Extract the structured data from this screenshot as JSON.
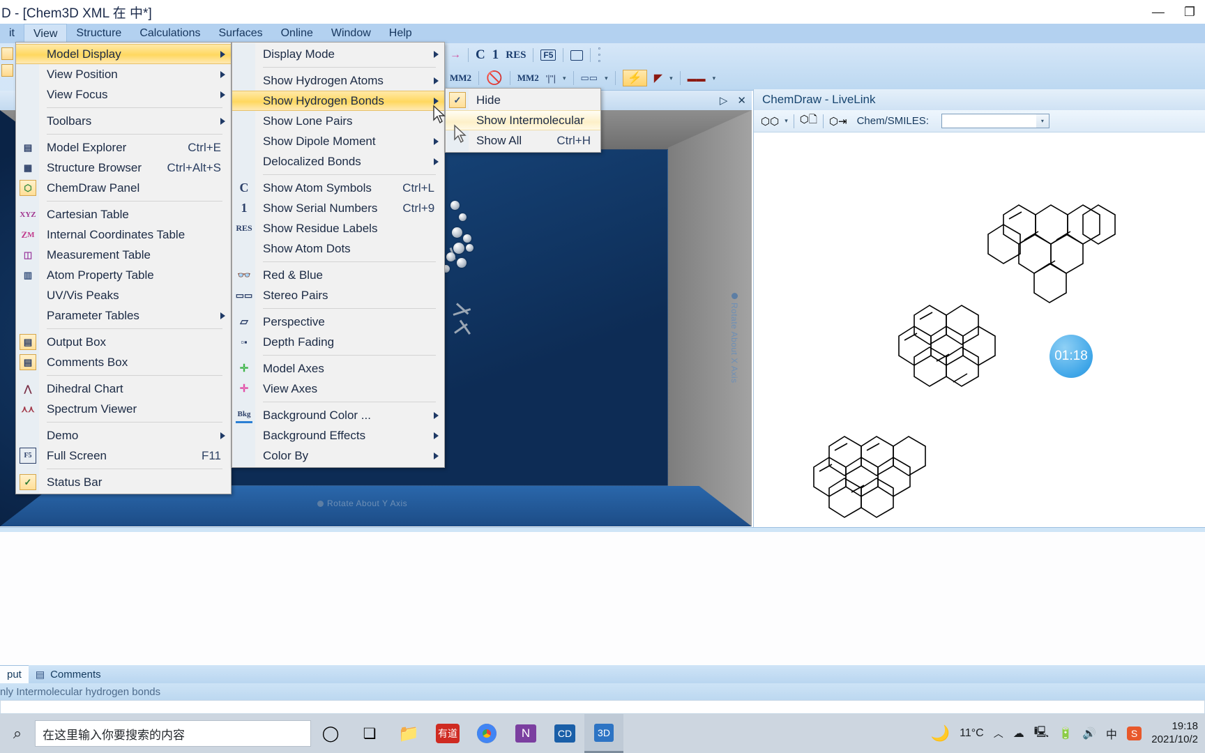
{
  "window": {
    "title": "D - [Chem3D XML 在 中*]",
    "controls": {
      "minimize": "—",
      "maximize": "❐"
    }
  },
  "menubar": {
    "items": [
      {
        "label": "it",
        "active": false
      },
      {
        "label": "View",
        "active": true
      },
      {
        "label": "Structure",
        "active": false
      },
      {
        "label": "Calculations",
        "active": false
      },
      {
        "label": "Surfaces",
        "active": false
      },
      {
        "label": "Online",
        "active": false
      },
      {
        "label": "Window",
        "active": false
      },
      {
        "label": "Help",
        "active": false
      }
    ]
  },
  "toolbar": {
    "row1": [
      "C",
      "1",
      "RES",
      "F5",
      "screen-icon",
      "dots-icon"
    ],
    "row2": [
      "MM2",
      "no-icon",
      "MM2",
      "bond-icon",
      "box-icon",
      "lightning-icon",
      "ramp-icon",
      "line-icon"
    ]
  },
  "view_menu": {
    "name": "View",
    "items": [
      {
        "icon": "",
        "label": "Model Display",
        "shortcut": "",
        "arrow": true,
        "highlight": "strong"
      },
      {
        "icon": "",
        "label": "View Position",
        "shortcut": "",
        "arrow": true
      },
      {
        "icon": "",
        "label": "View Focus",
        "shortcut": "",
        "arrow": true
      },
      {
        "separator": true
      },
      {
        "icon": "",
        "label": "Toolbars",
        "shortcut": "",
        "arrow": true
      },
      {
        "separator": true
      },
      {
        "icon": "model-explorer-icon",
        "label": "Model Explorer",
        "shortcut": "Ctrl+E"
      },
      {
        "icon": "structure-browser-icon",
        "label": "Structure Browser",
        "shortcut": "Ctrl+Alt+S"
      },
      {
        "icon": "chemdraw-panel-icon",
        "label": "ChemDraw Panel",
        "shortcut": "",
        "framed": true
      },
      {
        "separator": true
      },
      {
        "icon": "xyz-icon",
        "label": "Cartesian Table",
        "shortcut": ""
      },
      {
        "icon": "zm-icon",
        "label": "Internal Coordinates Table",
        "shortcut": ""
      },
      {
        "icon": "measurement-icon",
        "label": "Measurement Table",
        "shortcut": ""
      },
      {
        "icon": "atom-property-icon",
        "label": "Atom Property Table",
        "shortcut": ""
      },
      {
        "icon": "",
        "label": "UV/Vis Peaks",
        "shortcut": ""
      },
      {
        "icon": "",
        "label": "Parameter Tables",
        "shortcut": "",
        "arrow": true
      },
      {
        "separator": true
      },
      {
        "icon": "output-box-icon",
        "label": "Output Box",
        "shortcut": "",
        "framed": true
      },
      {
        "icon": "comments-box-icon",
        "label": "Comments Box",
        "shortcut": "",
        "framed": true
      },
      {
        "separator": true
      },
      {
        "icon": "dihedral-chart-icon",
        "label": "Dihedral Chart",
        "shortcut": ""
      },
      {
        "icon": "spectrum-viewer-icon",
        "label": "Spectrum Viewer",
        "shortcut": ""
      },
      {
        "separator": true
      },
      {
        "icon": "",
        "label": "Demo",
        "shortcut": "",
        "arrow": true
      },
      {
        "icon": "fullscreen-icon",
        "label": "Full Screen",
        "shortcut": "F11"
      },
      {
        "separator": true
      },
      {
        "icon": "check-icon",
        "label": "Status Bar",
        "shortcut": "",
        "framed": true
      }
    ]
  },
  "model_display_menu": {
    "name": "Model Display",
    "items": [
      {
        "icon": "",
        "label": "Display Mode",
        "shortcut": "",
        "arrow": true
      },
      {
        "separator": true
      },
      {
        "icon": "",
        "label": "Show Hydrogen Atoms",
        "shortcut": "",
        "arrow": true
      },
      {
        "icon": "",
        "label": "Show Hydrogen Bonds",
        "shortcut": "",
        "arrow": true,
        "highlight": "strong"
      },
      {
        "icon": "",
        "label": "Show Lone Pairs",
        "shortcut": ""
      },
      {
        "icon": "",
        "label": "Show Dipole Moment",
        "shortcut": "",
        "arrow": true
      },
      {
        "icon": "",
        "label": "Delocalized Bonds",
        "shortcut": "",
        "arrow": true
      },
      {
        "separator": true
      },
      {
        "icon": "C",
        "label": "Show Atom Symbols",
        "shortcut": "Ctrl+L"
      },
      {
        "icon": "1",
        "label": "Show Serial Numbers",
        "shortcut": "Ctrl+9"
      },
      {
        "icon": "RES",
        "label": "Show Residue Labels",
        "shortcut": ""
      },
      {
        "icon": "",
        "label": "Show Atom Dots",
        "shortcut": ""
      },
      {
        "separator": true
      },
      {
        "icon": "red-blue-glasses-icon",
        "label": "Red & Blue",
        "shortcut": ""
      },
      {
        "icon": "stereo-pairs-icon",
        "label": "Stereo Pairs",
        "shortcut": ""
      },
      {
        "separator": true
      },
      {
        "icon": "perspective-icon",
        "label": "Perspective",
        "shortcut": ""
      },
      {
        "icon": "depth-fading-icon",
        "label": "Depth Fading",
        "shortcut": ""
      },
      {
        "separator": true
      },
      {
        "icon": "model-axes-icon",
        "label": "Model Axes",
        "shortcut": ""
      },
      {
        "icon": "view-axes-icon",
        "label": "View Axes",
        "shortcut": ""
      },
      {
        "separator": true
      },
      {
        "icon": "bkg-icon",
        "label": "Background Color ...",
        "shortcut": "",
        "arrow": true
      },
      {
        "icon": "",
        "label": "Background Effects",
        "shortcut": "",
        "arrow": true
      },
      {
        "icon": "",
        "label": "Color By",
        "shortcut": "",
        "arrow": true
      }
    ]
  },
  "hydrogen_bonds_menu": {
    "name": "Show Hydrogen Bonds",
    "items": [
      {
        "icon": "check-icon",
        "label": "Hide",
        "shortcut": "",
        "framed": true,
        "checked": true
      },
      {
        "icon": "",
        "label": "Show Intermolecular",
        "shortcut": "",
        "highlight": "soft"
      },
      {
        "icon": "",
        "label": "Show All",
        "shortcut": "Ctrl+H"
      }
    ]
  },
  "viewport": {
    "hint_y": "Rotate About Y Axis",
    "hint_x": "Rotate About X Axis",
    "caption_controls": [
      "▷",
      "✕"
    ]
  },
  "livelink": {
    "title": "ChemDraw - LiveLink",
    "toolbar_icons": [
      "chem-structure-icon",
      "chevron-down-icon",
      "copy-structure-icon",
      "insert-structure-icon"
    ],
    "smiles_label": "Chem/SMILES:",
    "smiles_value": "",
    "timer_badge": "01:18"
  },
  "bottom_tabs": {
    "items": [
      {
        "label": "put",
        "selected": true,
        "icon": ""
      },
      {
        "label": "Comments",
        "selected": false,
        "icon": "comments-icon"
      }
    ]
  },
  "status_bar": {
    "text": "nly Intermolecular hydrogen bonds"
  },
  "taskbar": {
    "search_placeholder": "在这里输入你要搜索的内容",
    "icons": [
      {
        "name": "cortana-icon",
        "glyph": "◯"
      },
      {
        "name": "task-view-icon",
        "glyph": "❏"
      },
      {
        "name": "file-explorer-icon",
        "glyph": "📁"
      },
      {
        "name": "youdao-icon",
        "glyph": "有道"
      },
      {
        "name": "chrome-icon",
        "glyph": ""
      },
      {
        "name": "onenote-icon",
        "glyph": "N"
      },
      {
        "name": "chemdraw-icon",
        "glyph": "CD"
      },
      {
        "name": "chem3d-icon",
        "glyph": "3D",
        "selected": true
      }
    ],
    "weather": {
      "icon": "moon-icon",
      "temp": "11°C"
    },
    "tray": [
      "chevron-up-icon",
      "cloud-icon",
      "network-icon",
      "battery-icon",
      "volume-icon",
      "ime-chinese-icon",
      "sogou-icon"
    ],
    "clock": {
      "time": "19:18",
      "date": "2021/10/2"
    }
  }
}
